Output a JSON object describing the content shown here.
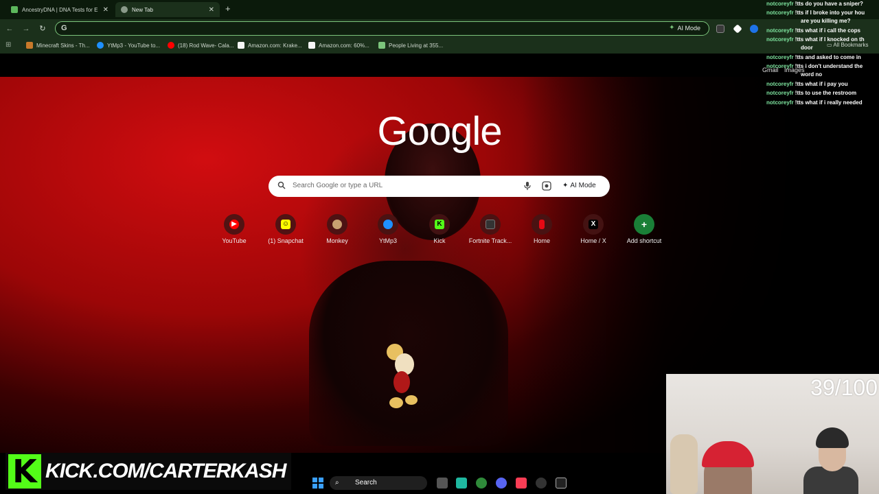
{
  "browser": {
    "tabs": [
      {
        "label": "AncestryDNA | DNA Tests for E",
        "active": false
      },
      {
        "label": "New Tab",
        "active": true
      }
    ],
    "omnibox": {
      "value": "",
      "ai_mode_label": "AI Mode"
    },
    "bookmarks": [
      {
        "label": "Minecraft Skins - Th..."
      },
      {
        "label": "YtMp3 - YouTube to..."
      },
      {
        "label": "(18) Rod Wave- Cala..."
      },
      {
        "label": "Amazon.com: Krake..."
      },
      {
        "label": "Amazon.com: 60%..."
      },
      {
        "label": "People Living at 355..."
      }
    ],
    "all_bookmarks_label": "All Bookmarks"
  },
  "newtab": {
    "logo_text": "Google",
    "gmail_label": "Gmail",
    "images_label": "Images",
    "search_placeholder": "Search Google or type a URL",
    "ai_mode_label": "AI Mode",
    "shortcuts": [
      {
        "label": "YouTube",
        "icon": "youtube-icon",
        "color": "#ff0000"
      },
      {
        "label": "(1) Snapchat",
        "icon": "snapchat-icon",
        "color": "#fffc00"
      },
      {
        "label": "Monkey",
        "icon": "monkey-icon",
        "color": "#c8a070"
      },
      {
        "label": "YtMp3",
        "icon": "ytmp3-icon",
        "color": "#1e90ff"
      },
      {
        "label": "Kick",
        "icon": "kick-icon",
        "color": "#53fc18"
      },
      {
        "label": "Fortnite Track...",
        "icon": "fortnite-tracker-icon",
        "color": "#333333"
      },
      {
        "label": "Home",
        "icon": "netflix-icon",
        "color": "#e50914"
      },
      {
        "label": "Home / X",
        "icon": "x-icon",
        "color": "#000000"
      },
      {
        "label": "Add shortcut",
        "icon": "plus-icon",
        "color": "#1a7f37"
      }
    ]
  },
  "chat": [
    {
      "user": "notcoreyfr",
      "msg": "!tts do you have a sniper?"
    },
    {
      "user": "notcoreyfr",
      "msg": "!tts if I broke into your hou"
    },
    {
      "user": "",
      "msg": "are you killing me?"
    },
    {
      "user": "notcoreyfr",
      "msg": "!tts what if i call the cops"
    },
    {
      "user": "notcoreyfr",
      "msg": "!tts what if I knocked on th"
    },
    {
      "user": "",
      "msg": "door"
    },
    {
      "user": "notcoreyfr",
      "msg": "!tts and asked to come in"
    },
    {
      "user": "notcoreyfr",
      "msg": "!tts i don't understand the"
    },
    {
      "user": "",
      "msg": "word no"
    },
    {
      "user": "notcoreyfr",
      "msg": "!tts what if i pay you"
    },
    {
      "user": "notcoreyfr",
      "msg": "!tts to use the restroom"
    },
    {
      "user": "notcoreyfr",
      "msg": "!tts what if i really needed"
    }
  ],
  "stream": {
    "kick_url": "KICK.COM/CARTERKASH",
    "counter": "39/100"
  },
  "taskbar": {
    "search_label": "Search"
  }
}
